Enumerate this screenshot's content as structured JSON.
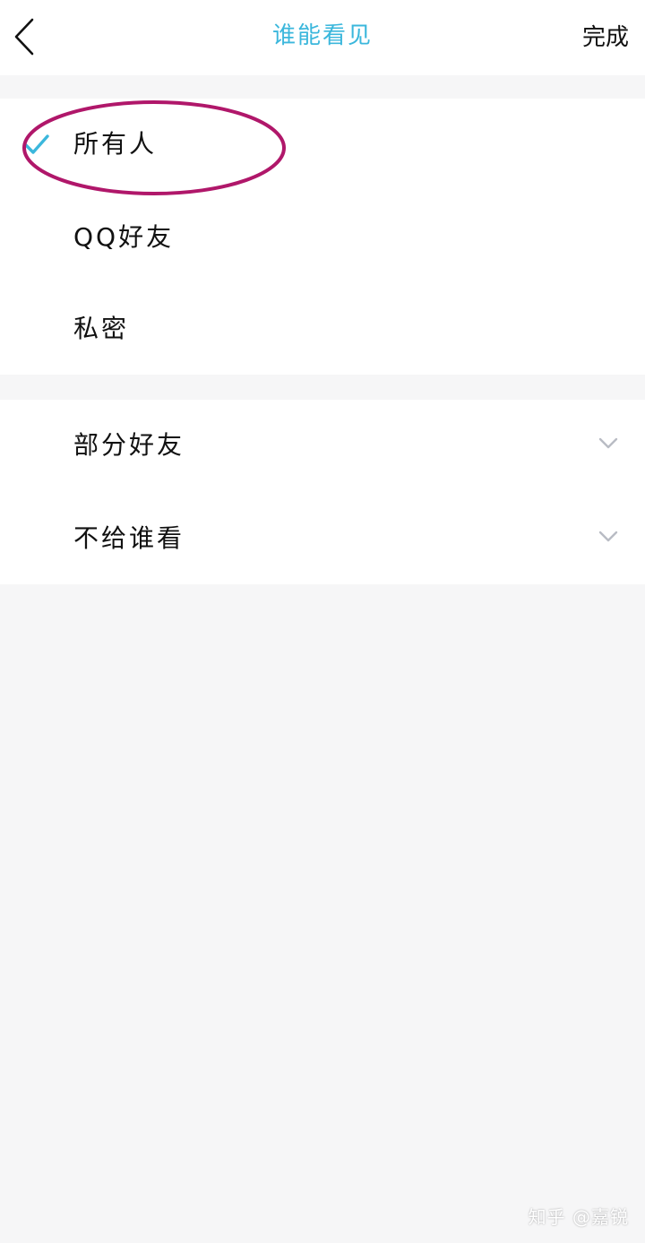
{
  "header": {
    "title": "谁能看见",
    "done_label": "完成"
  },
  "visibility_options": [
    {
      "label": "所有人",
      "selected": true
    },
    {
      "label": "QQ好友",
      "selected": false
    },
    {
      "label": "私密",
      "selected": false
    }
  ],
  "group_options": [
    {
      "label": "部分好友",
      "icon": "chevron-down-icon"
    },
    {
      "label": "不给谁看",
      "icon": "chevron-down-icon"
    }
  ],
  "colors": {
    "accent": "#3bb7dc",
    "annotation": "#b0176a",
    "chevron": "#b9bcc4"
  },
  "watermark": "知乎 @嘉锐"
}
